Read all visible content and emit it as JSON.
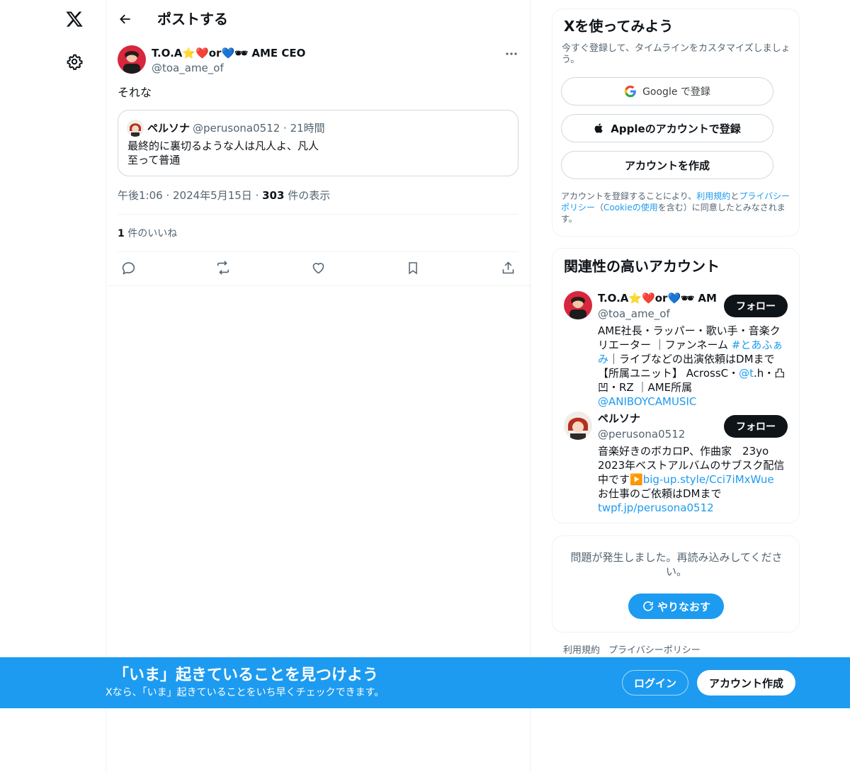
{
  "header": {
    "title": "ポストする"
  },
  "post": {
    "author_name": "T.O.A⭐❤️or💙🕶 AME CEO",
    "author_handle": "@toa_ame_of",
    "text": "それな",
    "timestamp": "午後1:06 · 2024年5月15日",
    "separator": " · ",
    "views_count": "303",
    "views_label": " 件の表示",
    "likes_count": "1",
    "likes_label": " 件のいいね"
  },
  "quote": {
    "author_name": "ペルソナ",
    "author_handle": "@perusona0512 · 21時間",
    "line1": "最終的に裏切るような人は凡人よ、凡人",
    "line2": "至って普通"
  },
  "signup_card": {
    "title": "Xを使ってみよう",
    "subtitle": "今すぐ登録して、タイムラインをカスタマイズしましょう。",
    "google_label": "Google で登録",
    "apple_label": "Appleのアカウントで登録",
    "create_label": "アカウントを作成",
    "legal_1": "アカウントを登録することにより、",
    "legal_terms": "利用規約",
    "legal_and": "と",
    "legal_privacy": "プライバシーポリシー",
    "legal_2": "（",
    "legal_cookie": "Cookieの使用",
    "legal_3": "を含む）に同意したとみなされます。"
  },
  "related": {
    "title": "関連性の高いアカウント",
    "accounts": [
      {
        "name": "T.O.A⭐❤️or💙🕶 AME CEO",
        "handle": "@toa_ame_of",
        "follow_label": "フォロー",
        "bio_1": "AME社長・ラッパー・歌い手・音楽クリエーター ｜ファンネーム ",
        "bio_tag": "#とあふぁみ",
        "bio_2": "｜ライブなどの出演依頼はDMまで 【所属ユニット】 AcrossC・",
        "bio_mention1": "@t",
        "bio_3": ".h・凸凹・RZ ｜AME所属 ",
        "bio_mention2": "@ANIBOYCAMUSIC"
      },
      {
        "name": "ペルソナ",
        "handle": "@perusona0512",
        "follow_label": "フォロー",
        "bio_1": "音楽好きのボカロP、作曲家　23yo 2023年ベストアルバムのサブスク配信中です▶️",
        "bio_link1": "big-up.style/Cci7iMxWue",
        "bio_2": " お仕事のご依頼はDMまで ",
        "bio_link2": "twpf.jp/perusona0512"
      }
    ]
  },
  "error_card": {
    "message": "問題が発生しました。再読み込みしてください。",
    "retry_label": "やりなおす"
  },
  "footer": {
    "terms": "利用規約",
    "privacy": "プライバシーポリシー"
  },
  "banner": {
    "title": "「いま」起きていることを見つけよう",
    "subtitle": "Xなら、「いま」起きていることをいち早くチェックできます。",
    "login_label": "ログイン",
    "signup_label": "アカウント作成"
  },
  "colors": {
    "accent": "#1d9bf0",
    "text": "#0f1419",
    "secondary": "#536471",
    "border": "#eff3f4"
  },
  "icons": [
    "x-logo-icon",
    "gear-icon",
    "back-arrow-icon",
    "more-icon",
    "reply-icon",
    "repost-icon",
    "like-icon",
    "bookmark-icon",
    "share-icon",
    "google-icon",
    "apple-icon",
    "refresh-icon"
  ]
}
